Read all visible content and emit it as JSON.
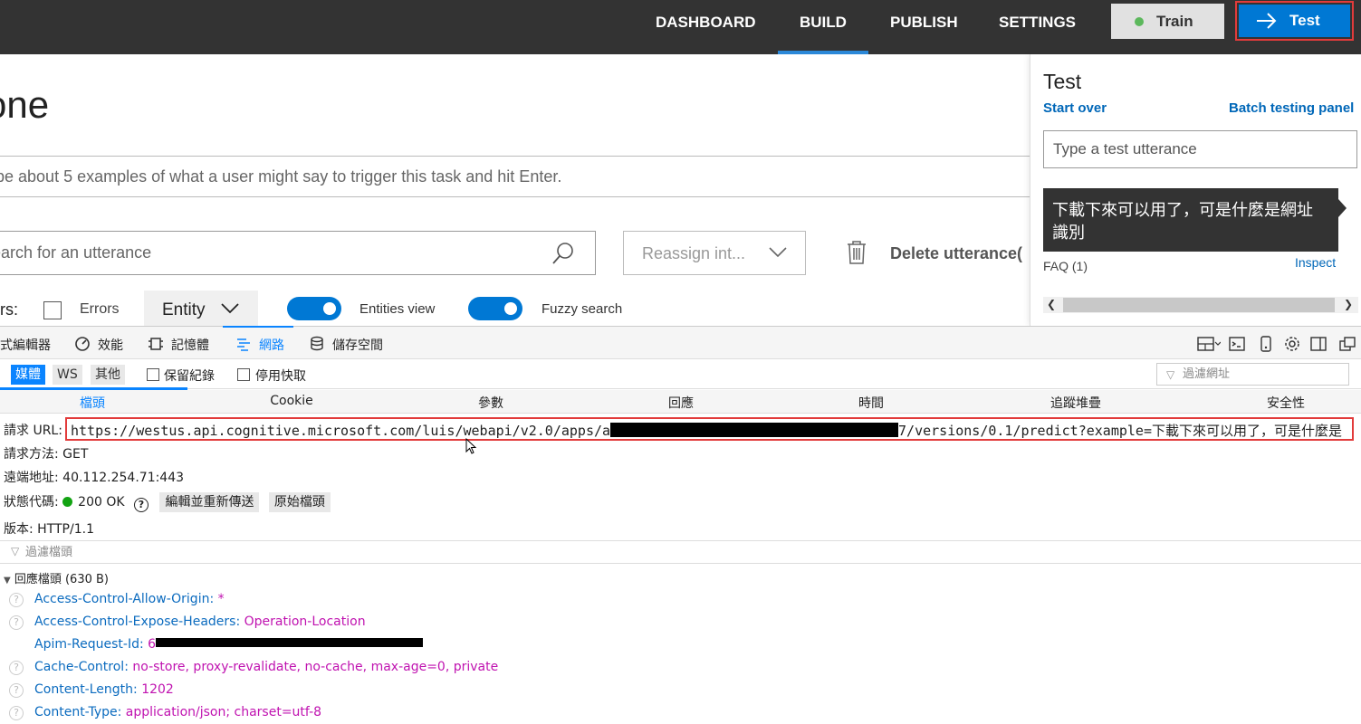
{
  "nav": {
    "items": [
      "DASHBOARD",
      "BUILD",
      "PUBLISH",
      "SETTINGS"
    ],
    "active": "BUILD",
    "train_label": "Train",
    "test_label": "Test"
  },
  "page": {
    "title": "one",
    "utterance_placeholder": "ype about 5 examples of what a user might say to trigger this task and hit Enter.",
    "search_placeholder": "earch for an utterance",
    "reassign_label": "Reassign int...",
    "delete_label": "Delete utterance(",
    "filters_label": "rs:",
    "errors_label": "Errors",
    "entity_label": "Entity",
    "entities_view_label": "Entities view",
    "fuzzy_search_label": "Fuzzy search"
  },
  "test_panel": {
    "title": "Test",
    "start_over": "Start over",
    "batch_testing": "Batch testing panel",
    "input_placeholder": "Type a test utterance",
    "utterance_line1": "下載下來可以用了，可是什麼是網址",
    "utterance_line2": "識別",
    "intent": "FAQ (1)",
    "inspect": "Inspect"
  },
  "devtools": {
    "tabs": [
      "式編輯器",
      "效能",
      "記憶體",
      "網路",
      "儲存空間"
    ],
    "active_tab": "網路",
    "filter_buttons": [
      "媒體",
      "WS",
      "其他"
    ],
    "active_filter": "媒體",
    "persist_logs": "保留紀錄",
    "disable_cache": "停用快取",
    "url_filter_placeholder": "過濾網址",
    "sub_tabs": [
      "檔頭",
      "Cookie",
      "參數",
      "回應",
      "時間",
      "追蹤堆疊",
      "安全性"
    ],
    "active_sub_tab": "檔頭",
    "request_url_label": "請求 URL:",
    "request_url_prefix": "https://westus.api.cognitive.microsoft.com/luis/webapi/v2.0/apps/a",
    "request_url_suffix": "7/versions/0.1/predict?example=下載下來可以用了，可是什麼是",
    "request_method_label": "請求方法:",
    "request_method": "GET",
    "remote_address_label": "遠端地址:",
    "remote_address": "40.112.254.71:443",
    "status_code_label": "狀態代碼:",
    "status_code": "200 OK",
    "edit_resend": "編輯並重新傳送",
    "raw_headers": "原始檔頭",
    "version_label": "版本:",
    "version": "HTTP/1.1",
    "header_filter_placeholder": "過濾檔頭",
    "response_headers_label": "回應檔頭 (630 B)",
    "response_headers": [
      {
        "name": "Access-Control-Allow-Origin:",
        "value": "*"
      },
      {
        "name": "Access-Control-Expose-Headers:",
        "value": "Operation-Location"
      },
      {
        "name": "Apim-Request-Id:",
        "value": "6"
      },
      {
        "name": "Cache-Control:",
        "value": "no-store, proxy-revalidate, no-cache, max-age=0, private"
      },
      {
        "name": "Content-Length:",
        "value": "1202"
      },
      {
        "name": "Content-Type:",
        "value": "application/json; charset=utf-8"
      }
    ]
  },
  "colors": {
    "nav_bg": "#333333",
    "accent": "#0078d4",
    "highlight_border": "#e23b3b",
    "devtools_accent": "#0a84ff",
    "header_name": "#0b6bbf",
    "header_value": "#c013b0"
  },
  "icons": [
    "arrow-right-icon",
    "search-icon",
    "chevron-down-icon",
    "trash-icon",
    "performance-icon",
    "memory-icon",
    "network-icon",
    "storage-icon",
    "funnel-icon",
    "help-icon",
    "mouse-cursor-icon"
  ]
}
